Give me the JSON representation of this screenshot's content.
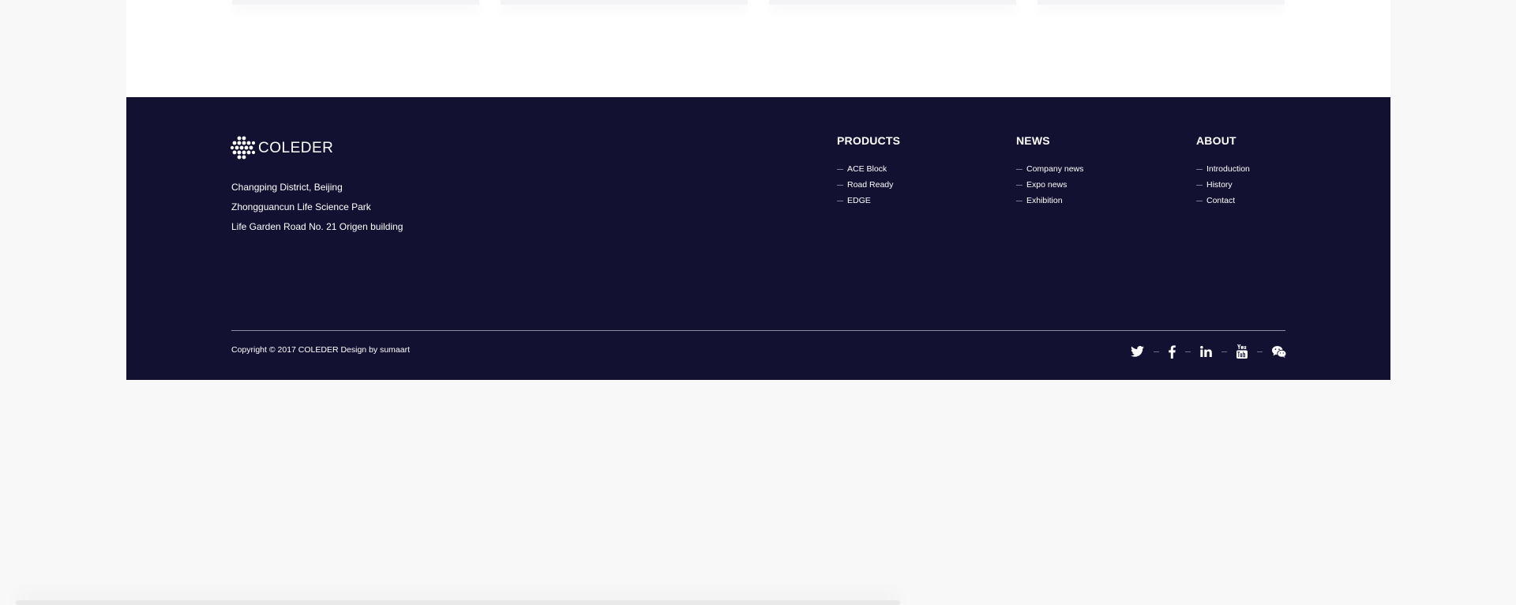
{
  "brand": {
    "name": "COLEDER"
  },
  "address": {
    "lines": [
      "Changping District, Beijing",
      "Zhongguancun Life Science Park",
      "Life Garden Road No. 21 Origen building"
    ]
  },
  "columns": [
    {
      "title": "PRODUCTS",
      "items": [
        "ACE Block",
        "Road Ready",
        "EDGE"
      ]
    },
    {
      "title": "NEWS",
      "items": [
        "Company news",
        "Expo news",
        "Exhibition"
      ]
    },
    {
      "title": "ABOUT",
      "items": [
        "Introduction",
        "History",
        "Contact"
      ]
    }
  ],
  "copyright": "Copyright © 2017 COLEDER Design by sumaart",
  "social": {
    "icons": [
      "twitter-icon",
      "facebook-icon",
      "linkedin-icon",
      "youtube-icon",
      "wechat-icon"
    ]
  },
  "colors": {
    "footer_bg": "#131131",
    "page_bg": "#f8f8f8",
    "text": "#ffffff"
  }
}
